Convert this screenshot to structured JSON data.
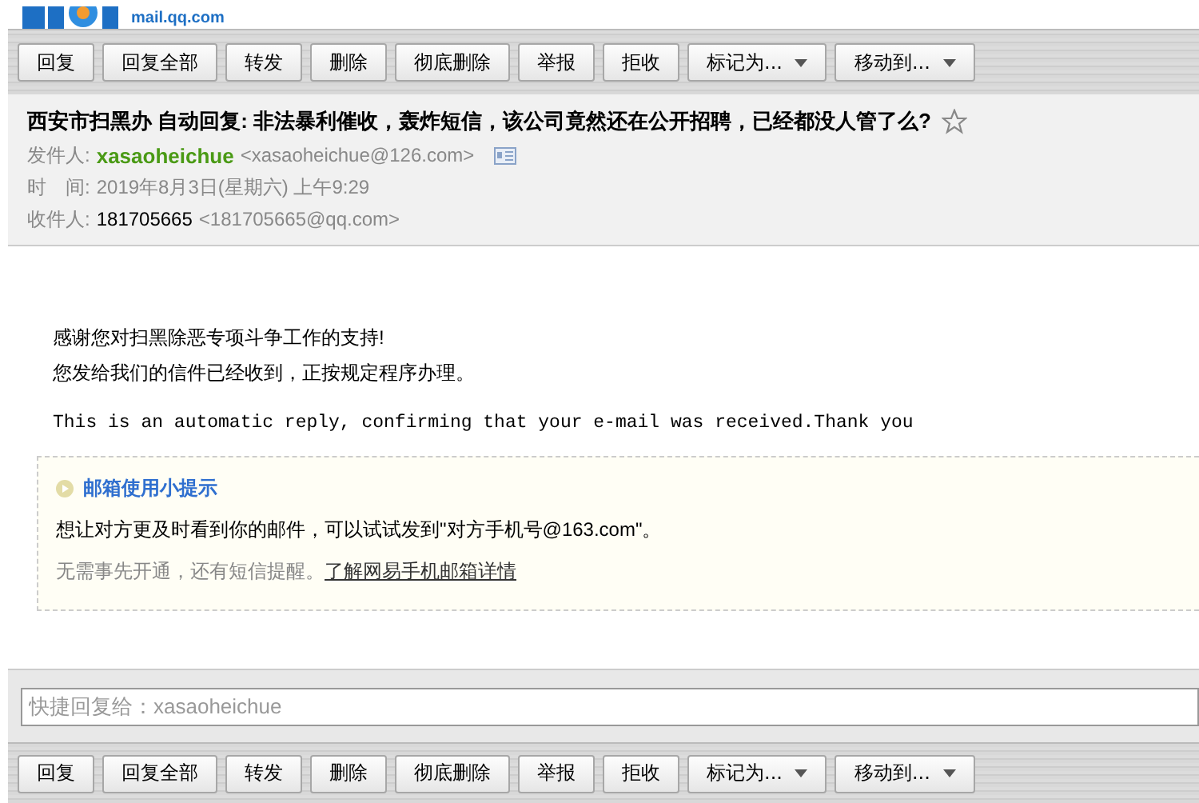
{
  "logo": {
    "domain": "mail.qq.com"
  },
  "toolbar_top": [
    {
      "label": "回复",
      "kind": "button"
    },
    {
      "label": "回复全部",
      "kind": "button"
    },
    {
      "label": "转发",
      "kind": "button"
    },
    {
      "label": "删除",
      "kind": "button"
    },
    {
      "label": "彻底删除",
      "kind": "button"
    },
    {
      "label": "举报",
      "kind": "button"
    },
    {
      "label": "拒收",
      "kind": "button"
    },
    {
      "label": "标记为...",
      "kind": "dropdown"
    },
    {
      "label": "移动到...",
      "kind": "dropdown"
    }
  ],
  "header": {
    "subject": "西安市扫黑办 自动回复: 非法暴利催收，轰炸短信，该公司竟然还在公开招聘，已经都没人管了么?",
    "starred": false,
    "from": {
      "label": "发件人:",
      "name": "xasaoheichue",
      "address": "<xasaoheichue@126.com>"
    },
    "time": {
      "label": "时　间:",
      "value": "2019年8月3日(星期六) 上午9:29"
    },
    "to": {
      "label": "收件人:",
      "name": "181705665",
      "address": "<181705665@qq.com>"
    }
  },
  "body": {
    "lines": [
      "感谢您对扫黑除恶专项斗争工作的支持!",
      "您发给我们的信件已经收到，正按规定程序办理。"
    ],
    "english": "This is an automatic reply, confirming that your e-mail was received.Thank you"
  },
  "tip": {
    "title": "邮箱使用小提示",
    "text": "想让对方更及时看到你的邮件，可以试试发到\"对方手机号@163.com\"。",
    "note": "无需事先开通，还有短信提醒。",
    "link": "了解网易手机邮箱详情"
  },
  "quick_reply": {
    "placeholder": "快捷回复给：xasaoheichue"
  },
  "toolbar_bottom": [
    {
      "label": "回复",
      "kind": "button"
    },
    {
      "label": "回复全部",
      "kind": "button"
    },
    {
      "label": "转发",
      "kind": "button"
    },
    {
      "label": "删除",
      "kind": "button"
    },
    {
      "label": "彻底删除",
      "kind": "button"
    },
    {
      "label": "举报",
      "kind": "button"
    },
    {
      "label": "拒收",
      "kind": "button"
    },
    {
      "label": "标记为...",
      "kind": "dropdown"
    },
    {
      "label": "移动到...",
      "kind": "dropdown"
    }
  ]
}
